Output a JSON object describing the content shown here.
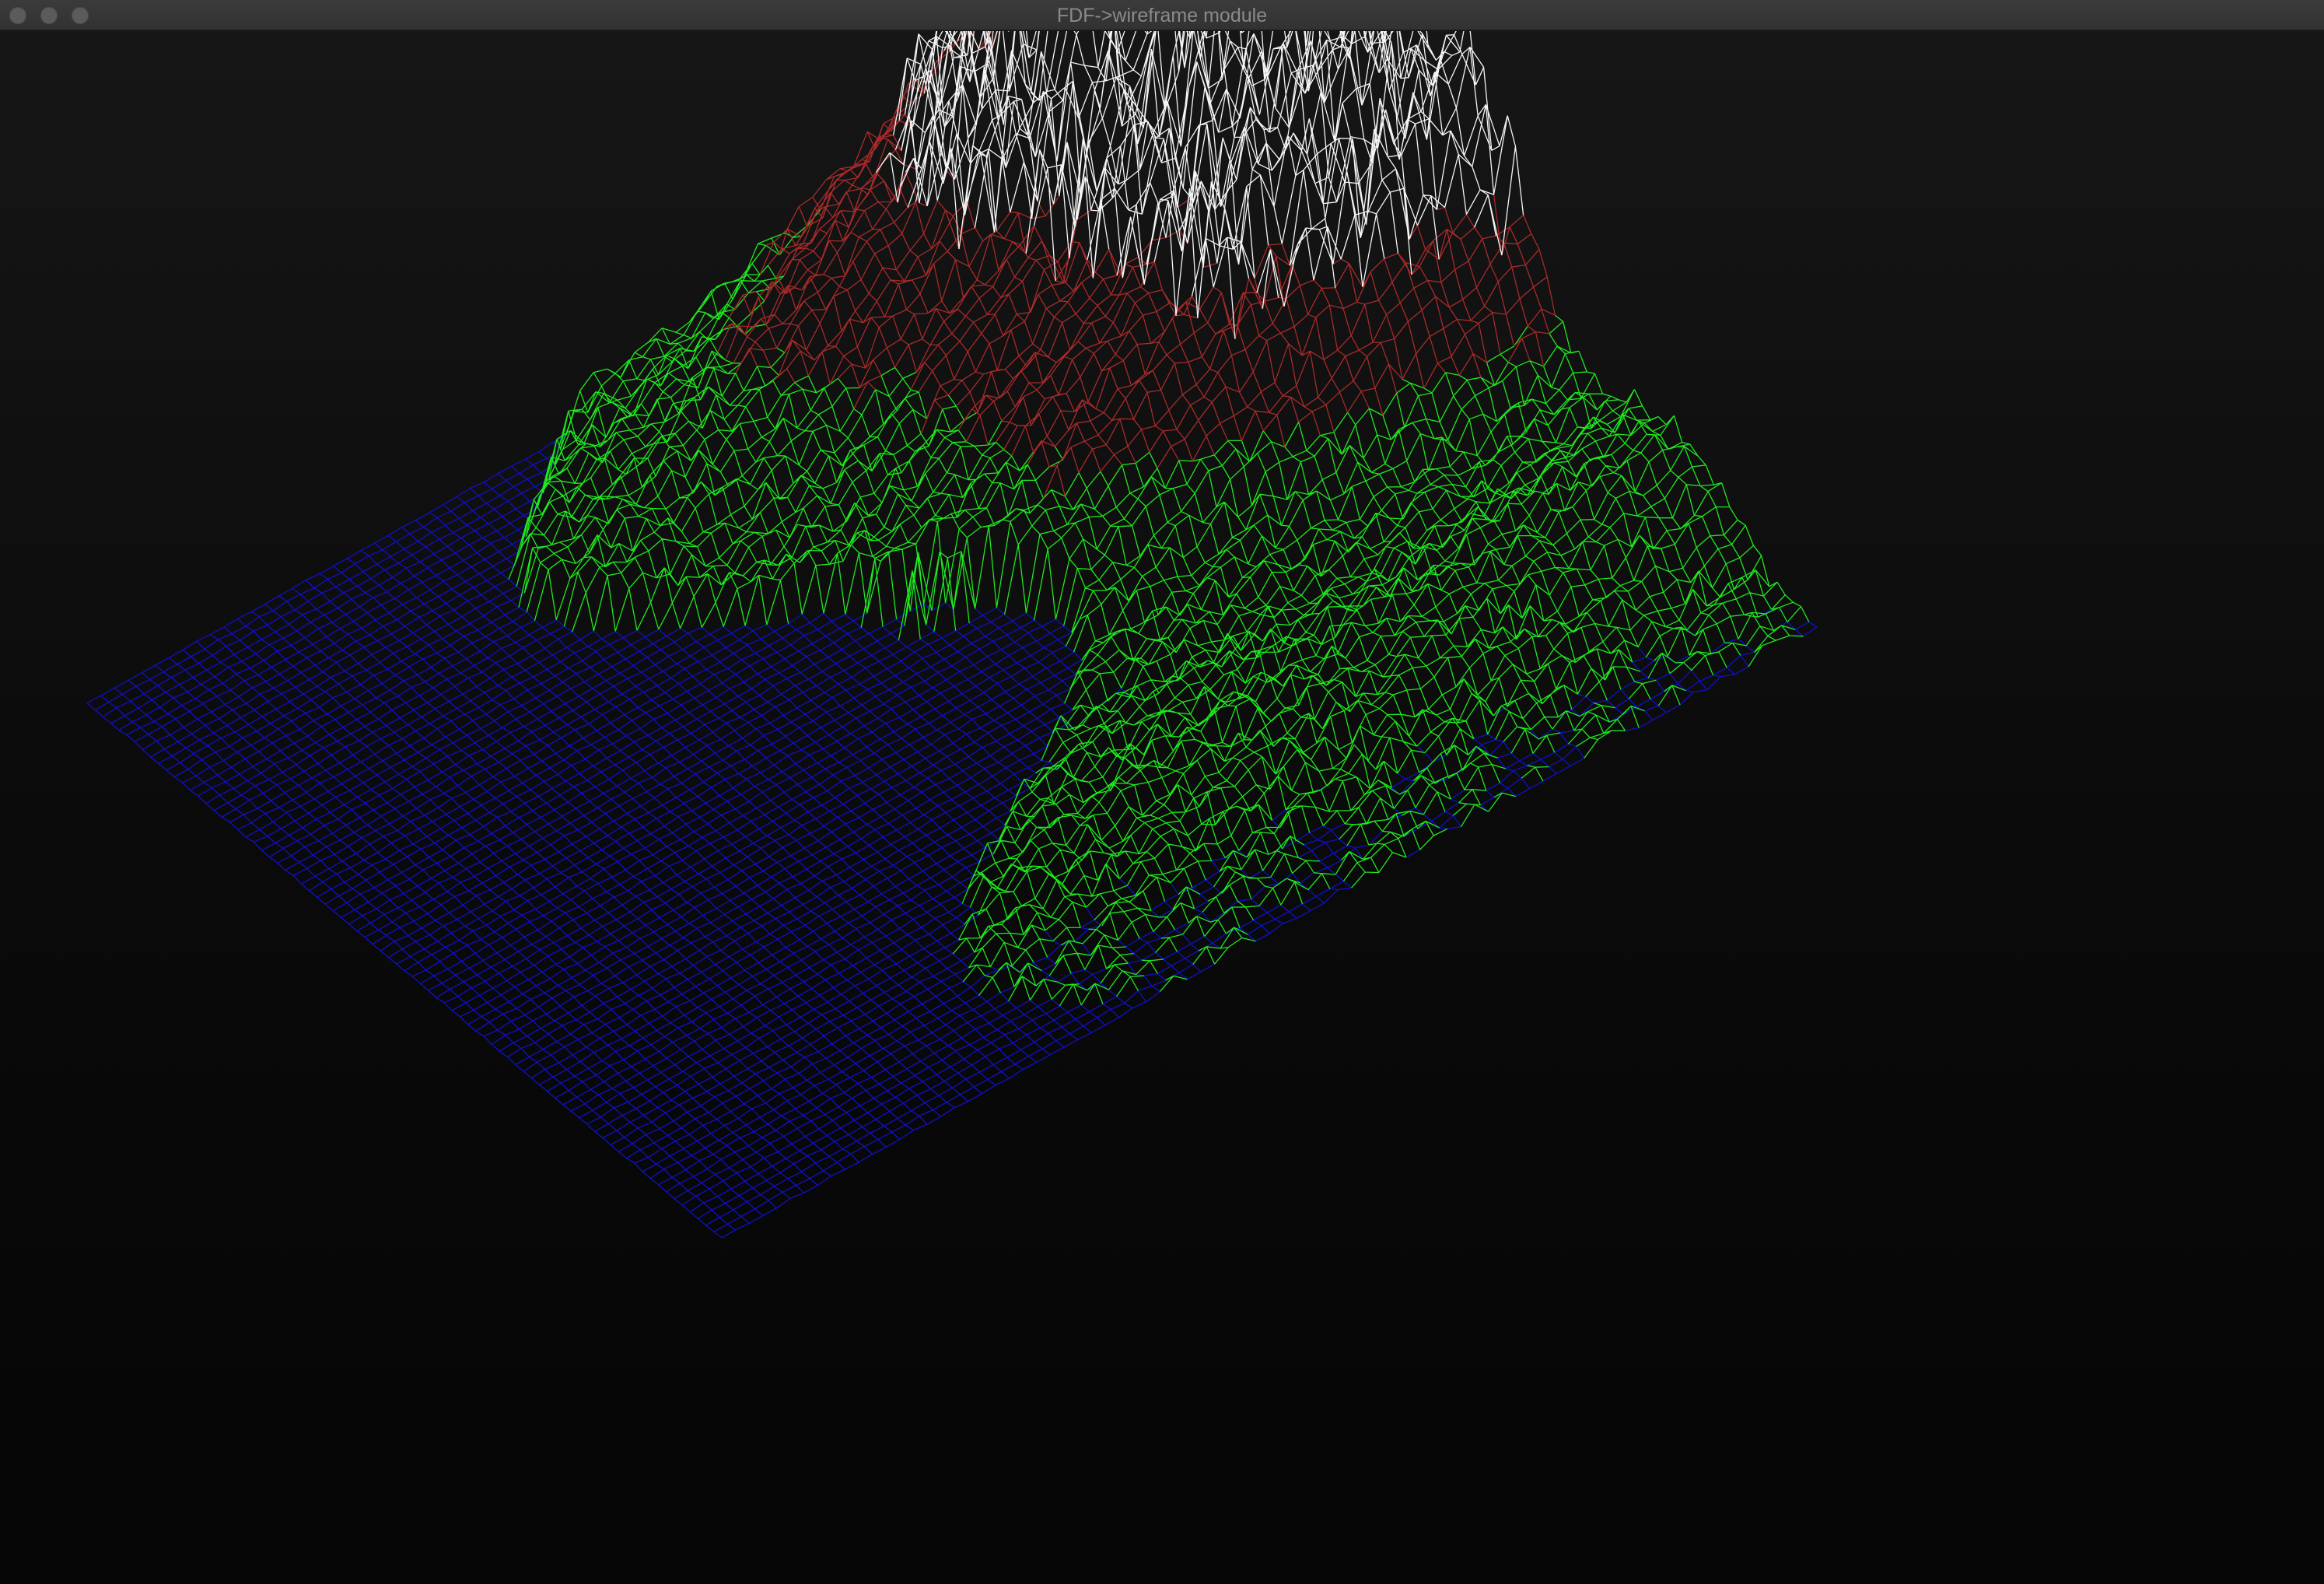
{
  "window": {
    "title": "FDF->wireframe module",
    "controls": [
      "close",
      "minimize",
      "maximize"
    ]
  },
  "render": {
    "colors": {
      "low": "#1010c8",
      "mid": "#1fe81f",
      "high": "#a82a2a",
      "peak": "#f4f4f4",
      "background": "#0c0c0c"
    }
  }
}
